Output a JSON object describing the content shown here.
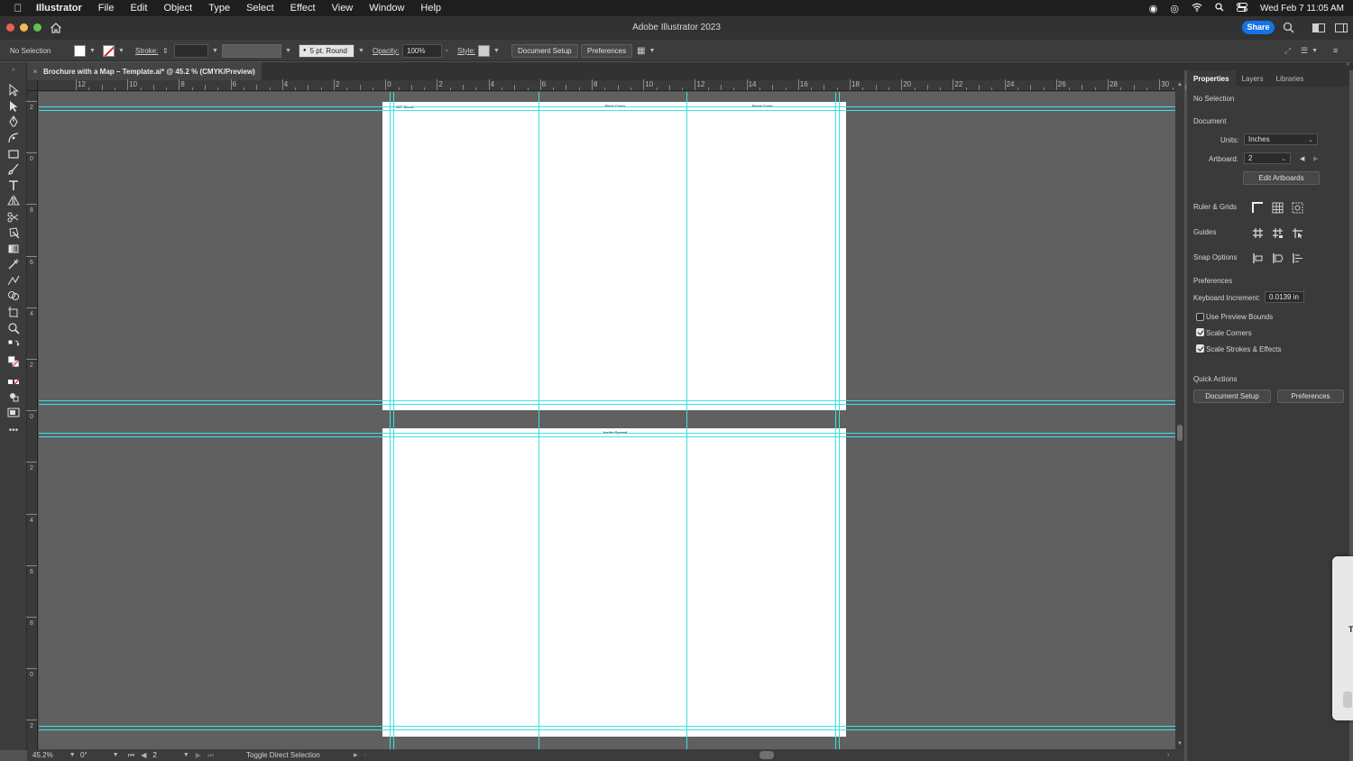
{
  "menubar": {
    "app_name": "Illustrator",
    "items": [
      "File",
      "Edit",
      "Object",
      "Type",
      "Select",
      "Effect",
      "View",
      "Window",
      "Help"
    ],
    "clock": "Wed Feb 7  11:05 AM"
  },
  "titlebar": {
    "title": "Adobe Illustrator 2023",
    "share_label": "Share"
  },
  "controlbar": {
    "selection": "No Selection",
    "stroke_label": "Stroke:",
    "brush_label": "5 pt. Round",
    "opacity_label": "Opacity:",
    "opacity_value": "100%",
    "style_label": "Style:",
    "document_setup": "Document Setup",
    "preferences": "Preferences"
  },
  "document_tab": {
    "title": "Brochure with a Map – Template.ai* @ 45.2 % (CMYK/Preview)"
  },
  "rulers": {
    "horizontal": [
      "12",
      "10",
      "8",
      "6",
      "4",
      "2",
      "0",
      "2",
      "4",
      "6",
      "8",
      "10",
      "12",
      "14",
      "16",
      "18",
      "20",
      "22",
      "24",
      "26",
      "28",
      "30"
    ],
    "vertical": [
      "2",
      "0",
      "8",
      "6",
      "4",
      "2",
      "0",
      "2",
      "4",
      "6",
      "8",
      "0",
      "2"
    ]
  },
  "artboards": {
    "top": {
      "labels": [
        "1/8\" Bleed",
        "Back Cover",
        "Front Cover"
      ]
    },
    "bottom": {
      "labels": [
        "Inside Spread"
      ]
    }
  },
  "statusbar": {
    "zoom": "45.2%",
    "rotation": "0°",
    "artboard": "2",
    "tool_hint": "Toggle Direct Selection"
  },
  "panel": {
    "tabs": [
      "Properties",
      "Layers",
      "Libraries"
    ],
    "selection": "No Selection",
    "document_heading": "Document",
    "units_label": "Units:",
    "units_value": "Inches",
    "artboard_label": "Artboard:",
    "artboard_value": "2",
    "edit_artboards": "Edit Artboards",
    "ruler_grids": "Ruler & Grids",
    "guides": "Guides",
    "snap_options": "Snap Options",
    "preferences_heading": "Preferences",
    "keyboard_increment_label": "Keyboard Increment:",
    "keyboard_increment_value": "0.0139 in",
    "use_preview_bounds": "Use Preview Bounds",
    "scale_corners": "Scale Corners",
    "scale_strokes": "Scale Strokes & Effects",
    "checks": {
      "use_preview_bounds": false,
      "scale_corners": true,
      "scale_strokes": true
    },
    "quick_actions": "Quick Actions",
    "document_setup": "Document Setup",
    "preferences_btn": "Preferences"
  },
  "float_panel": {
    "letter": "T"
  },
  "colors": {
    "guide": "#3fe0e0",
    "share": "#1473e6",
    "canvas": "#606060"
  }
}
